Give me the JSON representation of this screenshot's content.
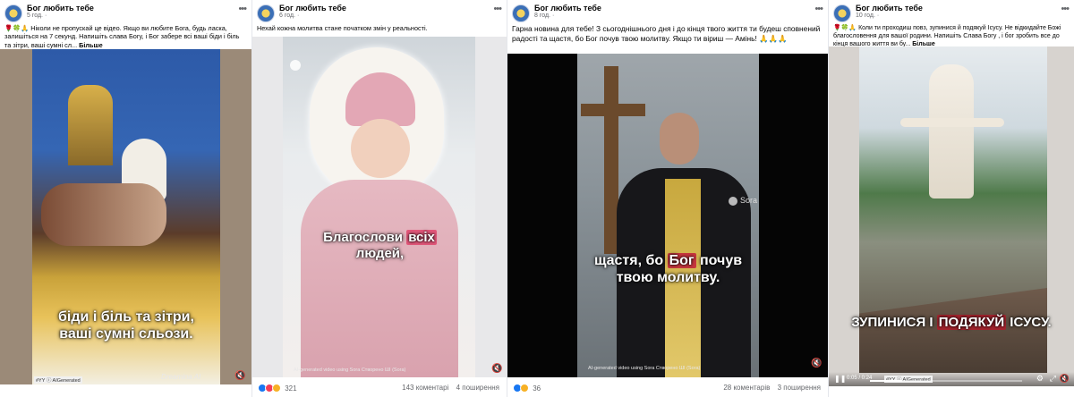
{
  "posts": [
    {
      "page_name": "Бог любить тебе",
      "time": "5 год. ·",
      "caption": "🌹🍀🙏 Ніколи не пропускай це відео. Якщо ви любите Бога, будь ласка, залишіться на 7 секунд. Напишіть слава Богу, і Бог забере всі ваші біди і біль та зітри, ваші сумні сл...",
      "more_label": "Більше",
      "subtitle": "біди і біль та зітри, ваші сумні сльози.",
      "tags": "#YY ⓘ  AIGenerated",
      "watermark": "Dreamina AI"
    },
    {
      "page_name": "Бог любить тебе",
      "time": "6 год. ·",
      "caption": "Нехай кожна молитва стане початком змін у реальності.",
      "subtitle_a": "Благослови",
      "subtitle_hl": "всіх",
      "subtitle_b": "людей,",
      "watermark": "AI-generated video using Sora Створено ШІ (Sora)",
      "reaction_count": "321",
      "comments": "143 коментарі",
      "shares": "4 поширення"
    },
    {
      "page_name": "Бог любить тебе",
      "time": "8 год. ·",
      "caption": "Гарна новина для тебе! З сьогоднішнього дня і до кінця твого життя ти будеш сповнений радості та щастя, бо Бог почув твою молитву. Якщо ти віриш — Амінь! 🙏🙏🙏",
      "subtitle_a": "щастя, бо",
      "subtitle_hl": "Бог",
      "subtitle_b": "почув",
      "subtitle_c": "твою молитву.",
      "sora_label": "Sora",
      "watermark": "AI-generated video using Sora Створено ШІ (Sora)",
      "reaction_count": "36",
      "comments": "28 коментарів",
      "shares": "3 поширення"
    },
    {
      "page_name": "Бог любить тебе",
      "time": "10 год. ·",
      "caption": "🌹🍀🙏 Коли ти проходиш повз, зупинися й подякуй Ісусу. Не відкидайте Божі благословення для вашої родини. Напишіть Слава Богу , і бог зробить все до кінця вашого життя ви бу...",
      "more_label": "Більше",
      "subtitle_a": "ЗУПИНИСЯ І",
      "subtitle_hl": "ПОДЯКУЙ",
      "subtitle_b": "ІСУСУ.",
      "time_code": "0:05 / 0:24",
      "tags": "#YY ⓘ  AIGenerated"
    }
  ],
  "colors": {
    "accent": "#1877f2",
    "highlight_pink": "#e4587b",
    "highlight_red": "#c7363e"
  }
}
